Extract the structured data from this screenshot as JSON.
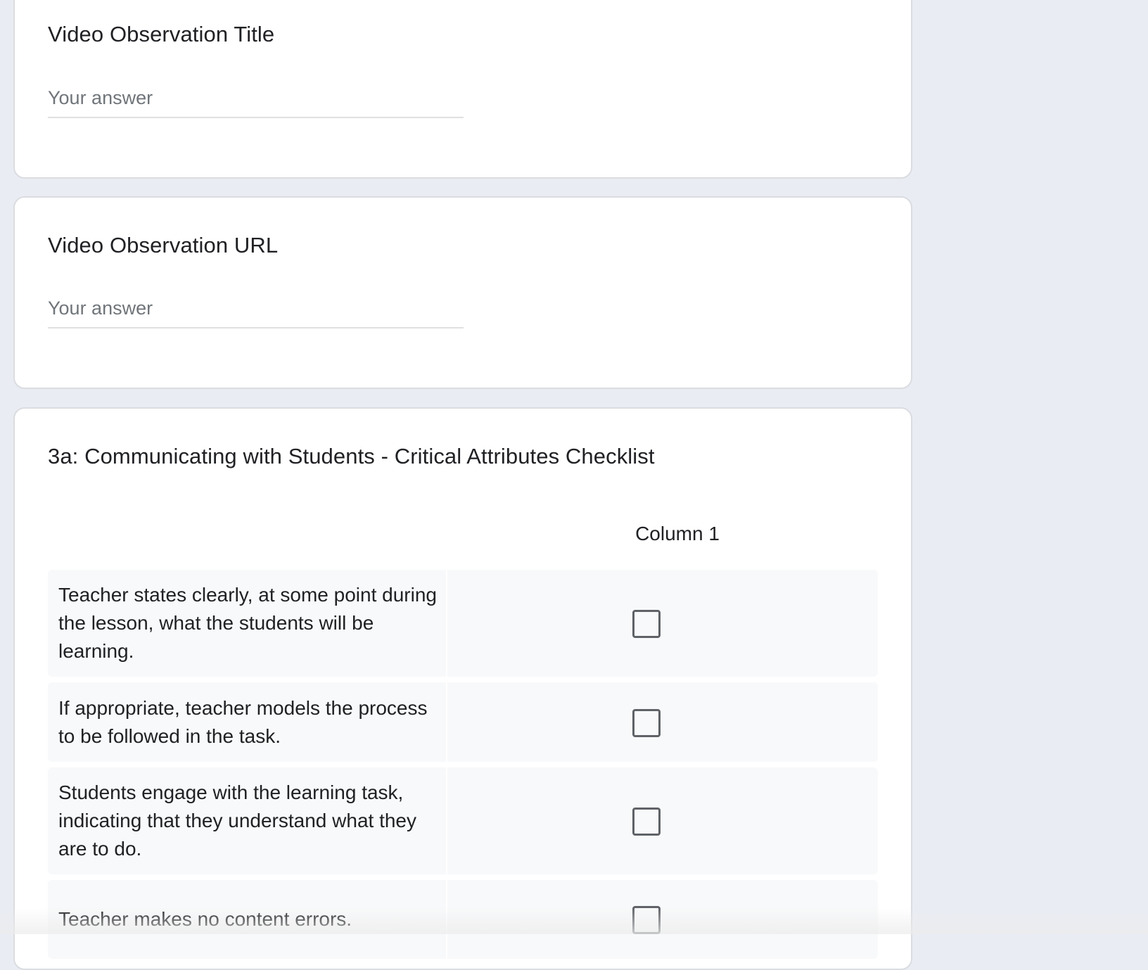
{
  "questions": [
    {
      "title": "Video Observation Title",
      "placeholder": "Your answer",
      "value": ""
    },
    {
      "title": "Video Observation URL",
      "placeholder": "Your answer",
      "value": ""
    }
  ],
  "checklist": {
    "title": "3a: Communicating with Students - Critical Attributes Checklist",
    "column_header": "Column 1",
    "rows": [
      {
        "label": "Teacher states clearly, at some point during the lesson, what the students will be learning.",
        "checked": false
      },
      {
        "label": "If appropriate, teacher models the process to be followed in the task.",
        "checked": false
      },
      {
        "label": "Students engage with the learning task, indicating that they understand what they are to do.",
        "checked": false
      },
      {
        "label": "Teacher makes no content errors.",
        "checked": false
      }
    ]
  },
  "colors": {
    "page_background": "#eaecf4",
    "card_background": "#ffffff",
    "card_border": "#dadce0",
    "row_background": "#f8f9fa",
    "text_primary": "#202124",
    "placeholder_text": "#70757a",
    "checkbox_border": "#5f6368"
  }
}
